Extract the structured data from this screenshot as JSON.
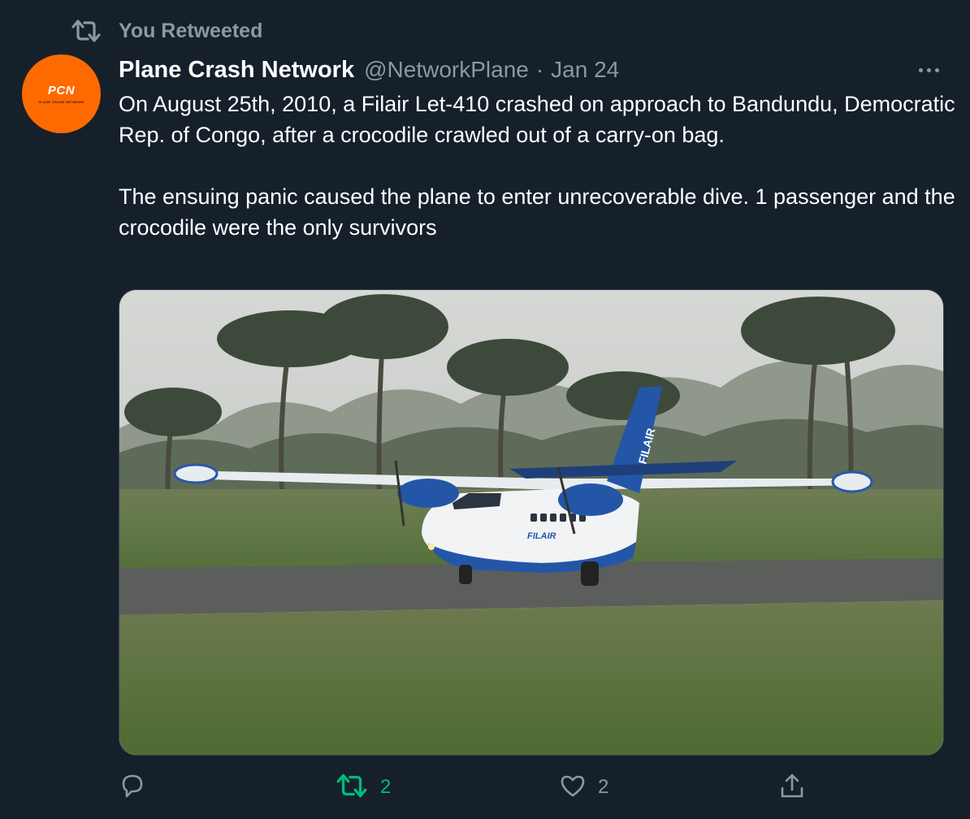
{
  "retweet_banner": {
    "label": "You Retweeted",
    "icon": "retweet-icon"
  },
  "author": {
    "avatar_text": "PCN",
    "avatar_subtext": "PLANE CRASH NETWORK",
    "avatar_color": "#ff6a00",
    "name": "Plane Crash Network",
    "handle": "@NetworkPlane",
    "separator": "·",
    "date": "Jan 24"
  },
  "tweet": {
    "paragraphs": [
      "On August 25th, 2010, a Filair Let-410 crashed on approach to Bandundu, Democratic Rep. of Congo, after a crocodile crawled out of a carry-on bag.",
      "The ensuing panic caused the plane to enter unrecoverable dive. 1 passenger and the crocodile were the only survivors"
    ],
    "media": {
      "subject": "blue-and-white twin-prop airplane on runway with palm trees",
      "tail_text": "FILAIR",
      "fuselage_text": "FILAIR"
    }
  },
  "actions": {
    "reply": {
      "icon": "reply-icon",
      "count": ""
    },
    "retweet": {
      "icon": "retweet-icon",
      "count": "2",
      "active": true,
      "color": "#00ba7c"
    },
    "like": {
      "icon": "heart-icon",
      "count": "2"
    },
    "share": {
      "icon": "share-icon",
      "count": ""
    }
  },
  "colors": {
    "background": "#15202b",
    "text": "#ffffff",
    "secondary": "#8b98a5"
  }
}
